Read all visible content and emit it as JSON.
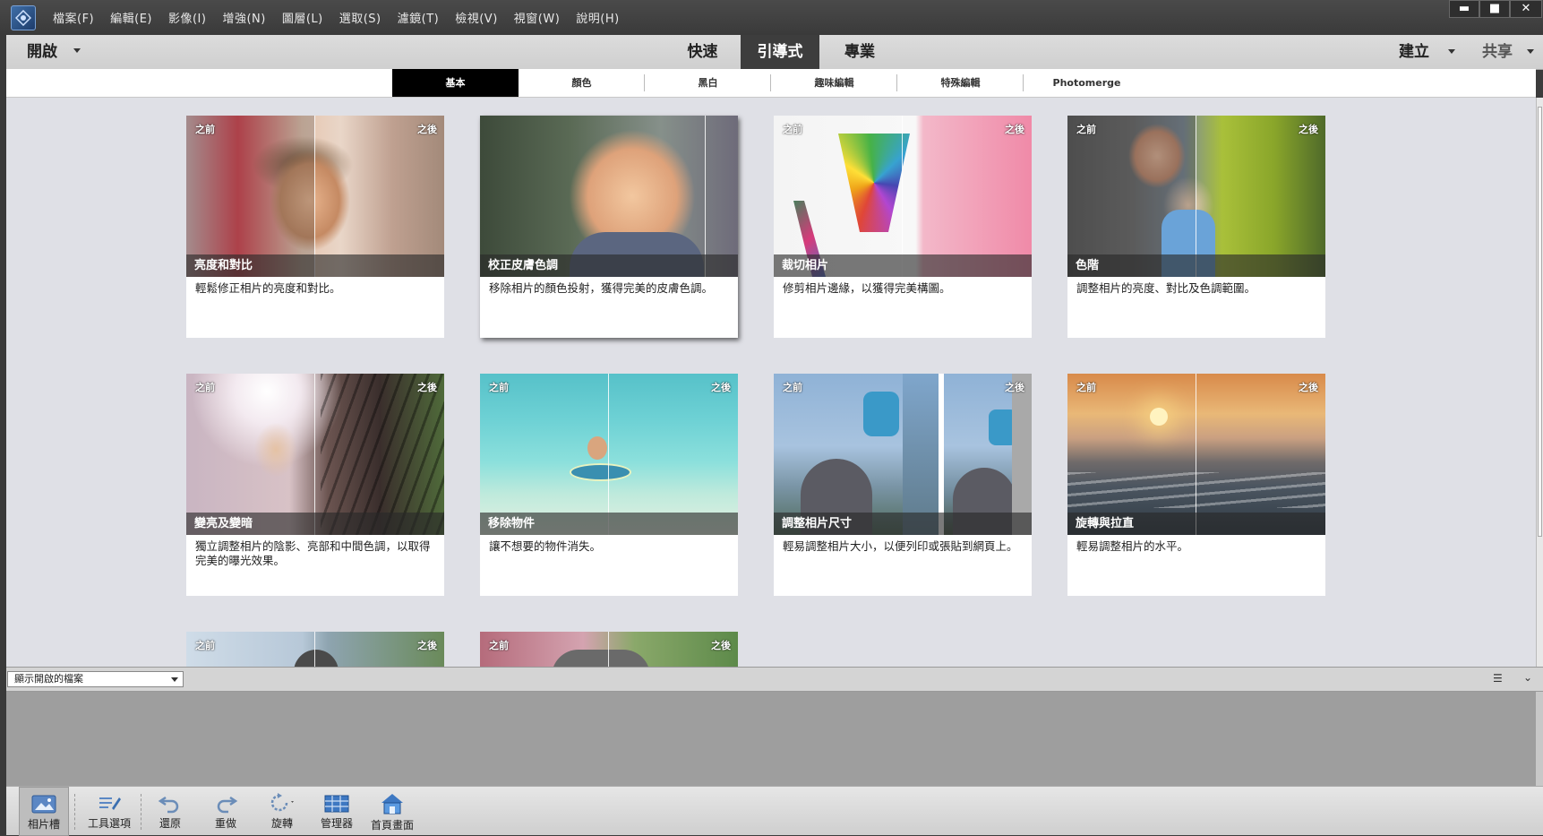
{
  "menu": {
    "items": [
      "檔案(F)",
      "編輯(E)",
      "影像(I)",
      "增強(N)",
      "圖層(L)",
      "選取(S)",
      "濾鏡(T)",
      "檢視(V)",
      "視窗(W)",
      "說明(H)"
    ]
  },
  "window_controls": {
    "minimize": "▬",
    "maximize": "■",
    "close": "✕"
  },
  "modebar": {
    "open": "開啟",
    "tabs": [
      "快速",
      "引導式",
      "專業"
    ],
    "active_tab": "引導式",
    "create": "建立",
    "share": "共享"
  },
  "subtabs": [
    "基本",
    "顏色",
    "黑白",
    "趣味編輯",
    "特殊編輯",
    "Photomerge"
  ],
  "active_subtab": "基本",
  "labels": {
    "before": "之前",
    "after": "之後"
  },
  "cards": [
    {
      "title": "亮度和對比",
      "desc": "輕鬆修正相片的亮度和對比。",
      "show_labels": true,
      "selected": false
    },
    {
      "title": "校正皮膚色調",
      "desc": "移除相片的顏色投射，獲得完美的皮膚色調。",
      "show_labels": false,
      "selected": true
    },
    {
      "title": "裁切相片",
      "desc": "修剪相片邊緣，以獲得完美構圖。",
      "show_labels": true,
      "selected": false
    },
    {
      "title": "色階",
      "desc": "調整相片的亮度、對比及色調範圍。",
      "show_labels": true,
      "selected": false
    },
    {
      "title": "變亮及變暗",
      "desc": "獨立調整相片的陰影、亮部和中間色調，以取得完美的曝光效果。",
      "show_labels": true,
      "selected": false
    },
    {
      "title": "移除物件",
      "desc": "讓不想要的物件消失。",
      "show_labels": true,
      "selected": false
    },
    {
      "title": "調整相片尺寸",
      "desc": "輕易調整相片大小，以便列印或張貼到網頁上。",
      "show_labels": true,
      "selected": false
    },
    {
      "title": "旋轉與拉直",
      "desc": "輕易調整相片的水平。",
      "show_labels": true,
      "selected": false
    }
  ],
  "binbar": {
    "select_value": "顯示開啟的檔案"
  },
  "bottom_tools": [
    {
      "label": "相片槽",
      "icon": "photo-bin-icon"
    },
    {
      "label": "工具選項",
      "icon": "tool-options-icon"
    },
    {
      "label": "還原",
      "icon": "undo-icon"
    },
    {
      "label": "重做",
      "icon": "redo-icon"
    },
    {
      "label": "旋轉",
      "icon": "rotate-icon"
    },
    {
      "label": "管理器",
      "icon": "organizer-icon"
    },
    {
      "label": "首頁畫面",
      "icon": "home-screen-icon"
    }
  ]
}
